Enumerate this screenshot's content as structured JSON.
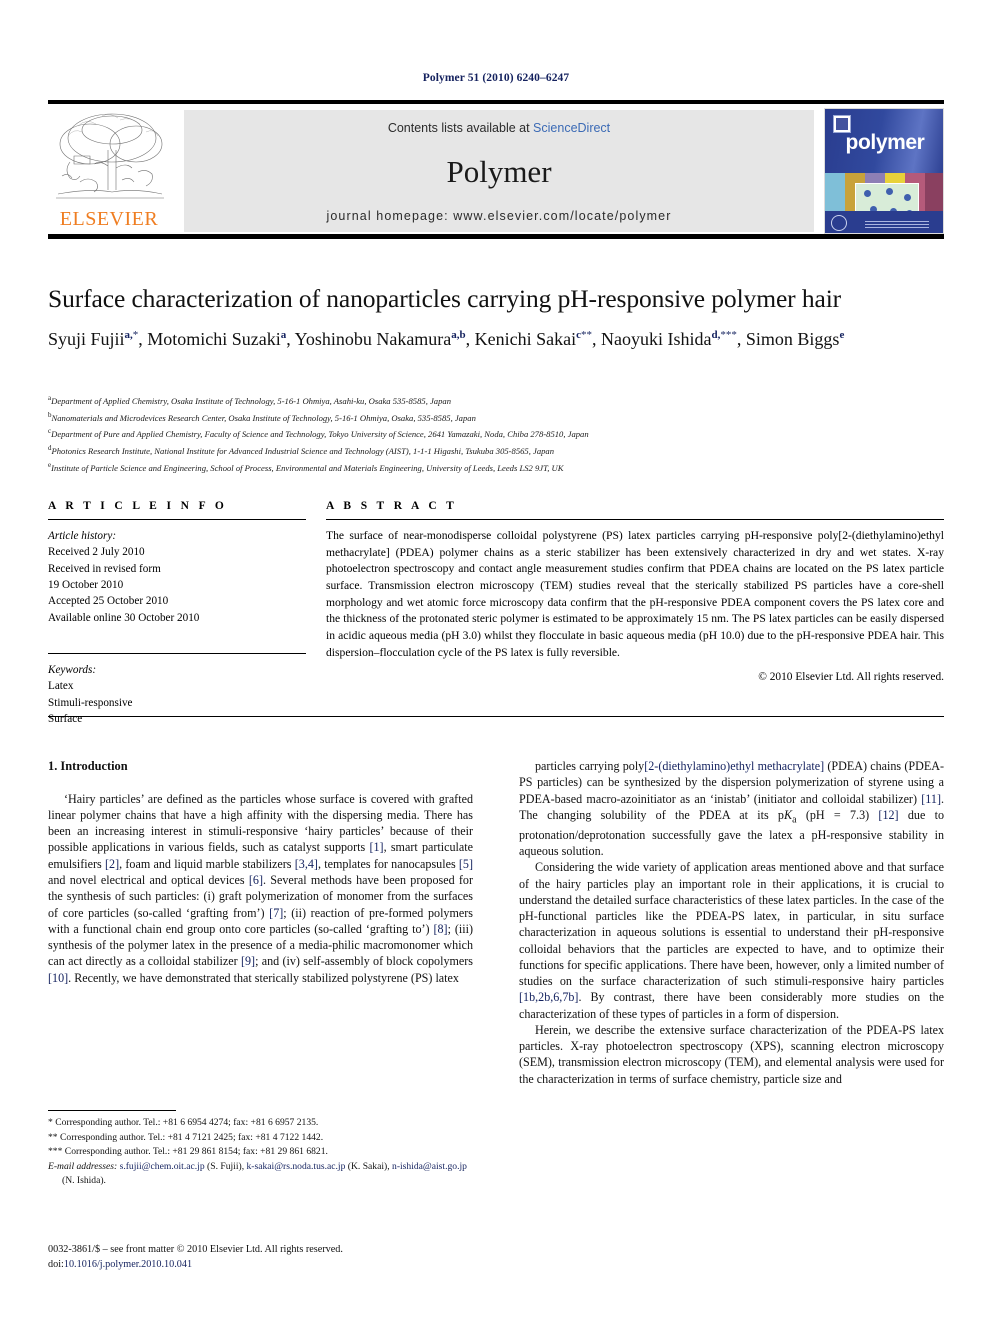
{
  "running_head": "Polymer 51 (2010) 6240–6247",
  "masthead": {
    "publisher_name": "ELSEVIER",
    "contents_prefix": "Contents lists available at ",
    "contents_link": "ScienceDirect",
    "journal_title": "Polymer",
    "homepage": "journal homepage: www.elsevier.com/locate/polymer",
    "cover_word": "polymer",
    "colors": {
      "elsevier_orange": "#ef7d21",
      "link_blue": "#3b6ab5",
      "banner_grey": "#e6e6e6",
      "cover_blue": "#2a3d8f",
      "accent_navy": "#13215e"
    }
  },
  "article": {
    "title": "Surface characterization of nanoparticles carrying pH-responsive polymer hair",
    "authors": [
      {
        "name": "Syuji Fujii",
        "sup": "a,",
        "star": "*",
        "sep": ", "
      },
      {
        "name": "Motomichi Suzaki",
        "sup": "a",
        "star": "",
        "sep": ", "
      },
      {
        "name": "Yoshinobu Nakamura",
        "sup": "a,b",
        "star": "",
        "sep": ", "
      },
      {
        "name": "Kenichi Sakai",
        "sup": "c",
        "star": "**",
        "sep": ", "
      },
      {
        "name": "Naoyuki Ishida",
        "sup": "d,",
        "star": "***",
        "sep": ", "
      },
      {
        "name": "Simon Biggs",
        "sup": "e",
        "star": "",
        "sep": ""
      }
    ],
    "affiliations": [
      {
        "mark": "a",
        "text": "Department of Applied Chemistry, Osaka Institute of Technology, 5-16-1 Ohmiya, Asahi-ku, Osaka 535-8585, Japan"
      },
      {
        "mark": "b",
        "text": "Nanomaterials and Microdevices Research Center, Osaka Institute of Technology, 5-16-1 Ohmiya, Osaka, 535-8585, Japan"
      },
      {
        "mark": "c",
        "text": "Department of Pure and Applied Chemistry, Faculty of Science and Technology, Tokyo University of Science, 2641 Yamazaki, Noda, Chiba 278-8510, Japan"
      },
      {
        "mark": "d",
        "text": "Photonics Research Institute, National Institute for Advanced Industrial Science and Technology (AIST), 1-1-1 Higashi, Tsukuba 305-8565, Japan"
      },
      {
        "mark": "e",
        "text": "Institute of Particle Science and Engineering, School of Process, Environmental and Materials Engineering, University of Leeds, Leeds LS2 9JT, UK"
      }
    ]
  },
  "article_info": {
    "heading": "A R T I C L E  I N F O",
    "history_label": "Article history:",
    "history": [
      "Received 2 July 2010",
      "Received in revised form",
      "19 October 2010",
      "Accepted 25 October 2010",
      "Available online 30 October 2010"
    ],
    "keywords_label": "Keywords:",
    "keywords": [
      "Latex",
      "Stimuli-responsive",
      "Surface"
    ]
  },
  "abstract": {
    "heading": "A B S T R A C T",
    "text": "The surface of near-monodisperse colloidal polystyrene (PS) latex particles carrying pH-responsive poly[2-(diethylamino)ethyl methacrylate] (PDEA) polymer chains as a steric stabilizer has been extensively characterized in dry and wet states. X-ray photoelectron spectroscopy and contact angle measurement studies confirm that PDEA chains are located on the PS latex particle surface. Transmission electron microscopy (TEM) studies reveal that the sterically stabilized PS particles have a core-shell morphology and wet atomic force microscopy data confirm that the pH-responsive PDEA component covers the PS latex core and the thickness of the protonated steric polymer is estimated to be approximately 15 nm. The PS latex particles can be easily dispersed in acidic aqueous media (pH 3.0) whilst they flocculate in basic aqueous media (pH 10.0) due to the pH-responsive PDEA hair. This dispersion–flocculation cycle of the PS latex is fully reversible.",
    "copyright": "© 2010 Elsevier Ltd. All rights reserved."
  },
  "body": {
    "section_number_title": "1. Introduction",
    "left_paragraphs": [
      "‘Hairy particles’ are defined as the particles whose surface is covered with grafted linear polymer chains that have a high affinity with the dispersing media. There has been an increasing interest in stimuli-responsive ‘hairy particles’ because of their possible applications in various fields, such as catalyst supports [1], smart particulate emulsifiers [2], foam and liquid marble stabilizers [3,4], templates for nanocapsules [5] and novel electrical and optical devices [6]. Several methods have been proposed for the synthesis of such particles: (i) graft polymerization of monomer from the surfaces of core particles (so-called ‘grafting from’) [7]; (ii) reaction of pre-formed polymers with a functional chain end group onto core particles (so-called ‘grafting to’) [8]; (iii) synthesis of the polymer latex in the presence of a media-philic macromonomer which can act directly as a colloidal stabilizer [9]; and (iv) self-assembly of block copolymers [10]. Recently, we have demonstrated that sterically stabilized polystyrene (PS) latex"
    ],
    "right_paragraphs": [
      "particles carrying poly[2-(diethylamino)ethyl methacrylate] (PDEA) chains (PDEA-PS particles) can be synthesized by the dispersion polymerization of styrene using a PDEA-based macro-azoinitiator as an ‘inistab’ (initiator and colloidal stabilizer) [11]. The changing solubility of the PDEA at its pKa (pH = 7.3) [12] due to protonation/deprotonation successfully gave the latex a pH-responsive stability in aqueous solution.",
      "Considering the wide variety of application areas mentioned above and that surface of the hairy particles play an important role in their applications, it is crucial to understand the detailed surface characteristics of these latex particles. In the case of the pH-functional particles like the PDEA-PS latex, in particular, in situ surface characterization in aqueous solutions is essential to understand their pH-responsive colloidal behaviors that the particles are expected to have, and to optimize their functions for specific applications. There have been, however, only a limited number of studies on the surface characterization of such stimuli-responsive hairy particles [1b,2b,6,7b]. By contrast, there have been considerably more studies on the characterization of these types of particles in a form of dispersion.",
      "Herein, we describe the extensive surface characterization of the PDEA-PS latex particles. X-ray photoelectron spectroscopy (XPS), scanning electron microscopy (SEM), transmission electron microscopy (TEM), and elemental analysis were used for the characterization in terms of surface chemistry, particle size and"
    ]
  },
  "footnotes": {
    "lines": [
      "* Corresponding author. Tel.: +81 6 6954 4274; fax: +81 6 6957 2135.",
      "** Corresponding author. Tel.: +81 4 7121 2425; fax: +81 4 7122 1442.",
      "*** Corresponding author. Tel.: +81 29 861 8154; fax: +81 29 861 6821."
    ],
    "email_label": "E-mail addresses:",
    "emails": [
      {
        "address": "s.fujii@chem.oit.ac.jp",
        "owner": "(S. Fujii)"
      },
      {
        "address": "k-sakai@rs.noda.tus.ac.jp",
        "owner": "(K. Sakai)"
      },
      {
        "address": "n-ishida@aist.go.jp",
        "owner": "(N. Ishida)"
      }
    ]
  },
  "imprint": {
    "line1": "0032-3861/$ – see front matter © 2010 Elsevier Ltd. All rights reserved.",
    "doi_label": "doi:",
    "doi": "10.1016/j.polymer.2010.10.041"
  }
}
